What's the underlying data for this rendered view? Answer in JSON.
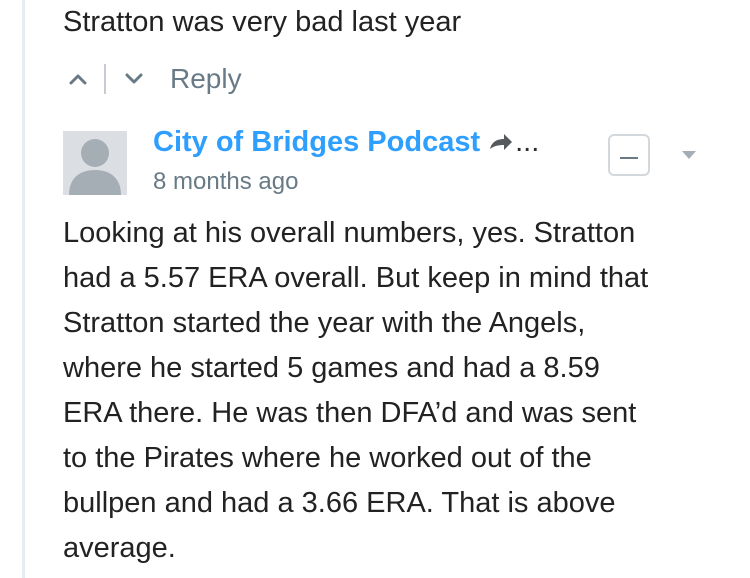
{
  "parent_comment": {
    "text": "Stratton was very bad last year",
    "actions": {
      "upvote_icon": "chevron-up-icon",
      "downvote_icon": "chevron-down-icon",
      "reply_label": "Reply"
    }
  },
  "reply_comment": {
    "author": "City of Bridges Podcast",
    "author_suffix": "...",
    "share_icon": "share-arrow-icon",
    "timestamp": "8 months ago",
    "collapse_icon": "minus-icon",
    "menu_icon": "chevron-down-icon",
    "body_lines": [
      "Looking at his overall numbers, yes. Stratton",
      "had a 5.57 ERA overall. But keep in mind that",
      "Stratton started the year with the Angels,",
      "where he started 5 games and had a 8.59",
      "ERA there. He was then DFA’d and was sent",
      "to the Pirates where he worked out of the",
      "bullpen and had a 3.66 ERA. That is above",
      "average."
    ]
  },
  "colors": {
    "link_blue": "#2e9fff",
    "text_dark": "#222222",
    "text_muted": "#687a86",
    "thread_line": "#e8ecef",
    "avatar_bg": "#dbdfe4",
    "avatar_fg": "#a5adb5"
  }
}
